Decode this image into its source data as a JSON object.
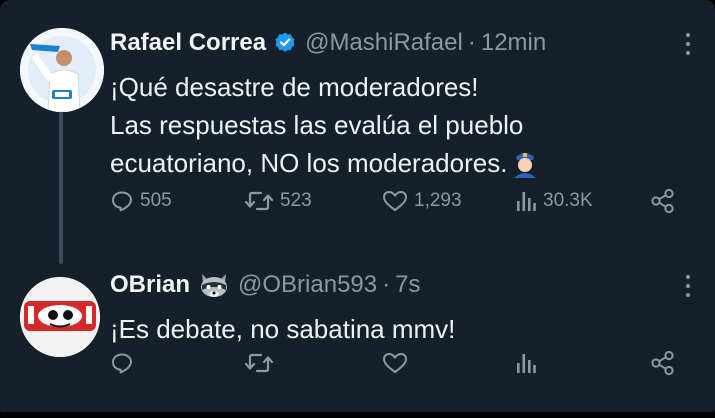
{
  "tweets": [
    {
      "display_name": "Rafael Correa",
      "handle": "@MashiRafael",
      "separator": "·",
      "time": "12min",
      "text_lines": [
        "¡Qué desastre de moderadores!",
        "Las respuestas las evalúa el pueblo",
        "ecuatoriano, NO los moderadores."
      ],
      "stats": {
        "replies": "505",
        "retweets": "523",
        "likes": "1,293",
        "views": "30.3K"
      },
      "icons": [
        "verified-badge-icon",
        "reply-icon",
        "retweet-icon",
        "like-icon",
        "views-icon",
        "share-icon",
        "more-icon"
      ]
    },
    {
      "display_name": "OBrian",
      "handle": "@OBrian593",
      "separator": "·",
      "time": "7s",
      "text_lines": [
        "¡Es debate, no sabatina mmv!"
      ],
      "icons": [
        "raccoon-emoji-icon",
        "reply-icon",
        "retweet-icon",
        "like-icon",
        "views-icon",
        "share-icon",
        "more-icon"
      ]
    }
  ],
  "colors": {
    "background": "#15202b",
    "text": "#e7e9ea",
    "muted": "#8b98a5",
    "verified": "#1d9bf0"
  }
}
